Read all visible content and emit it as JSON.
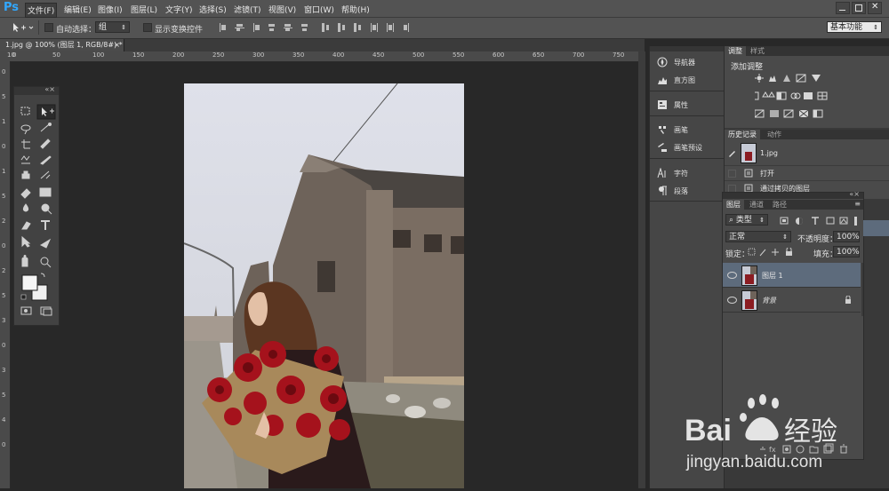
{
  "menubar": {
    "logo": "Ps",
    "items": [
      "文件(F)",
      "编辑(E)",
      "图像(I)",
      "图层(L)",
      "文字(Y)",
      "选择(S)",
      "滤镜(T)",
      "视图(V)",
      "窗口(W)",
      "帮助(H)"
    ]
  },
  "options": {
    "auto_select_label": "自动选择：",
    "auto_select_value": "组",
    "show_transform_label": "显示变换控件",
    "workspace": "基本功能"
  },
  "document": {
    "tab_title": "1.jpg @ 100% (图层 1, RGB/8#) *",
    "close": "×"
  },
  "ruler": {
    "h": [
      "10",
      "0",
      "50",
      "100",
      "150",
      "200",
      "250",
      "300",
      "350",
      "400",
      "450",
      "500",
      "550",
      "600",
      "650",
      "700",
      "750"
    ],
    "v": [
      "0",
      "5",
      "1",
      "0",
      "1",
      "5",
      "2",
      "0",
      "2",
      "5",
      "3",
      "0",
      "3",
      "5",
      "4",
      "0"
    ]
  },
  "middock": {
    "items": [
      {
        "label": "导航器",
        "icon": "compass-icon"
      },
      {
        "label": "直方图",
        "icon": "histogram-icon"
      },
      {
        "label": "属性",
        "icon": "properties-icon"
      },
      {
        "label": "画笔",
        "icon": "brush-icon"
      },
      {
        "label": "画笔预设",
        "icon": "brush-presets-icon"
      },
      {
        "label": "字符",
        "icon": "character-icon"
      },
      {
        "label": "段落",
        "icon": "paragraph-icon"
      }
    ]
  },
  "adjustments": {
    "tabs": [
      "调整",
      "样式"
    ],
    "title": "添加调整"
  },
  "history": {
    "tabs": [
      "历史记录",
      "动作"
    ],
    "snapshot": "1.jpg",
    "items": [
      "打开",
      "通过拷贝的图层"
    ]
  },
  "layers": {
    "tabs": [
      "图层",
      "通道",
      "路径"
    ],
    "filter_kind": "类型",
    "blend_mode": "正常",
    "opacity_label": "不透明度：",
    "opacity": "100%",
    "lock_label": "锁定：",
    "fill_label": "填充：",
    "fill": "100%",
    "rows": [
      {
        "name": "图层 1",
        "selected": true
      },
      {
        "name": "背景",
        "selected": false,
        "locked": true
      }
    ]
  },
  "watermark": {
    "brand": "Bai",
    "brand2": "经验",
    "url": "jingyan.baidu.com"
  },
  "colors": {
    "accent": "#31a8ff",
    "selected_layer": "#5d6b7c",
    "roses": "#a5121c"
  }
}
